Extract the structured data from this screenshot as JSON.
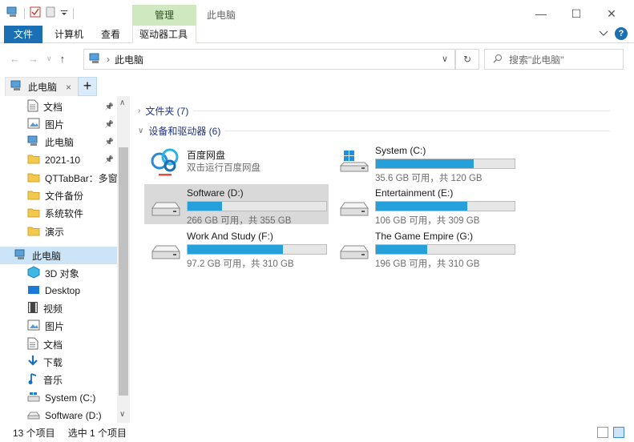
{
  "title_bar": {
    "context_tab_label": "管理",
    "window_title": "此电脑",
    "minimize_glyph": "—",
    "maximize_glyph": "☐",
    "close_glyph": "✕"
  },
  "ribbon": {
    "file_tab": "文件",
    "tabs": [
      "计算机",
      "查看"
    ],
    "context_tab": "驱动器工具",
    "help_glyph": "?"
  },
  "navigation": {
    "breadcrumb_location": "此电脑",
    "search_placeholder": "搜索\"此电脑\""
  },
  "qttab": {
    "active_tab_label": "此电脑",
    "close_glyph": "×",
    "new_tab_glyph": "+"
  },
  "sidebar": {
    "quick_access": [
      {
        "label": "文档",
        "icon": "document-icon",
        "pinned": true
      },
      {
        "label": "图片",
        "icon": "picture-icon",
        "pinned": true
      },
      {
        "label": "此电脑",
        "icon": "computer-icon",
        "pinned": true
      },
      {
        "label": "2021-10",
        "icon": "folder-icon",
        "pinned": true
      },
      {
        "label": "QTTabBar：多窗口",
        "icon": "folder-icon",
        "pinned": false
      },
      {
        "label": "文件备份",
        "icon": "folder-icon",
        "pinned": false
      },
      {
        "label": "系统软件",
        "icon": "folder-icon",
        "pinned": false
      },
      {
        "label": "演示",
        "icon": "folder-icon",
        "pinned": false
      }
    ],
    "this_pc": {
      "label": "此电脑",
      "icon": "computer-icon"
    },
    "this_pc_children": [
      {
        "label": "3D 对象",
        "icon": "3d-objects-icon"
      },
      {
        "label": "Desktop",
        "icon": "desktop-icon"
      },
      {
        "label": "视频",
        "icon": "video-icon"
      },
      {
        "label": "图片",
        "icon": "picture-icon"
      },
      {
        "label": "文档",
        "icon": "document-icon"
      },
      {
        "label": "下载",
        "icon": "download-icon"
      },
      {
        "label": "音乐",
        "icon": "music-icon"
      },
      {
        "label": "System (C:)",
        "icon": "system-drive-icon"
      },
      {
        "label": "Software (D:)",
        "icon": "drive-icon"
      }
    ]
  },
  "content": {
    "folders_group": "文件夹 (7)",
    "devices_group": "设备和驱动器 (6)",
    "baidu": {
      "name": "百度网盘",
      "subtitle": "双击运行百度网盘"
    },
    "drives": [
      {
        "name": "System (C:)",
        "free_label": "35.6 GB 可用，共 120 GB",
        "used_fraction": 0.703,
        "icon": "system-drive-icon",
        "selected": false
      },
      {
        "name": "Software (D:)",
        "free_label": "266 GB 可用，共 355 GB",
        "used_fraction": 0.251,
        "icon": "drive-icon",
        "selected": true
      },
      {
        "name": "Entertainment (E:)",
        "free_label": "106 GB 可用，共 309 GB",
        "used_fraction": 0.657,
        "icon": "drive-icon",
        "selected": false
      },
      {
        "name": "Work And Study (F:)",
        "free_label": "97.2 GB 可用，共 310 GB",
        "used_fraction": 0.686,
        "icon": "drive-icon",
        "selected": false
      },
      {
        "name": "The Game Empire (G:)",
        "free_label": "196 GB 可用，共 310 GB",
        "used_fraction": 0.368,
        "icon": "drive-icon",
        "selected": false
      }
    ],
    "bar_color": "#26a0da"
  },
  "status_bar": {
    "item_count": "13 个项目",
    "selection": "选中 1 个项目"
  }
}
